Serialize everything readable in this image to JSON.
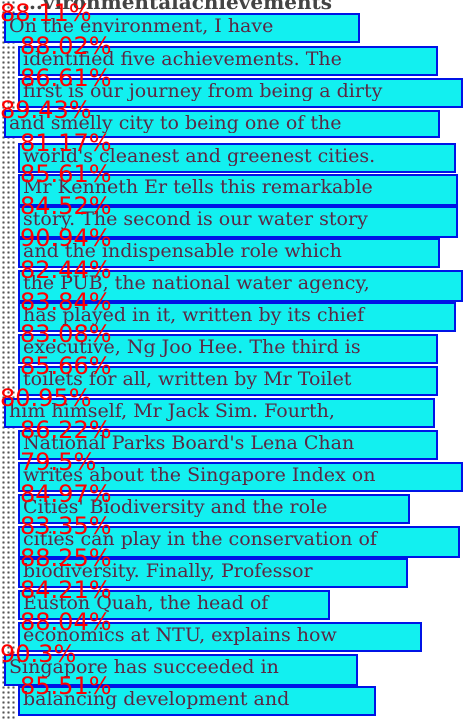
{
  "heading_fragment": "...vironmentalachievements",
  "lines": [
    {
      "text": "On the environment, I have",
      "score": "88.11%"
    },
    {
      "text": "identified five achievements. The",
      "score": "88.02%"
    },
    {
      "text": "first is our journey from being a dirty",
      "score": "86.61%"
    },
    {
      "text": "and smelly city to being one of the",
      "score": "89.43%"
    },
    {
      "text": "world's cleanest and greenest cities.",
      "score": "81.17%"
    },
    {
      "text": "Mr Kenneth Er tells this remarkable",
      "score": "85.61%"
    },
    {
      "text": "story. The second is our water story",
      "score": "84.52%"
    },
    {
      "text": "and the indispensable role which",
      "score": "90.94%"
    },
    {
      "text": "the PUB, the national water agency,",
      "score": "82.44%"
    },
    {
      "text": "has played in it, written by its chief",
      "score": "83.84%"
    },
    {
      "text": "executive, Ng Joo Hee. The third is",
      "score": "83.08%"
    },
    {
      "text": "toilets for all, written by Mr Toilet",
      "score": "85.66%"
    },
    {
      "text": "him himself, Mr Jack Sim. Fourth,",
      "score": "80.95%"
    },
    {
      "text": "National Parks Board's Lena Chan",
      "score": "86.22%"
    },
    {
      "text": "writes about the Singapore Index on",
      "score": "79.5%"
    },
    {
      "text": "Cities' Biodiversity and the role",
      "score": "84.97%"
    },
    {
      "text": "cities can play in the conservation of",
      "score": "83.35%"
    },
    {
      "text": "biodiversity. Finally, Professor",
      "score": "88.25%"
    },
    {
      "text": "Euston Quah, the head of",
      "score": "84.21%"
    },
    {
      "text": "economics at NTU, explains how",
      "score": "88.04%"
    },
    {
      "text": "Singapore has succeeded in",
      "score": "90.3%"
    },
    {
      "text": "balancing development and",
      "score": "85.51%"
    }
  ]
}
